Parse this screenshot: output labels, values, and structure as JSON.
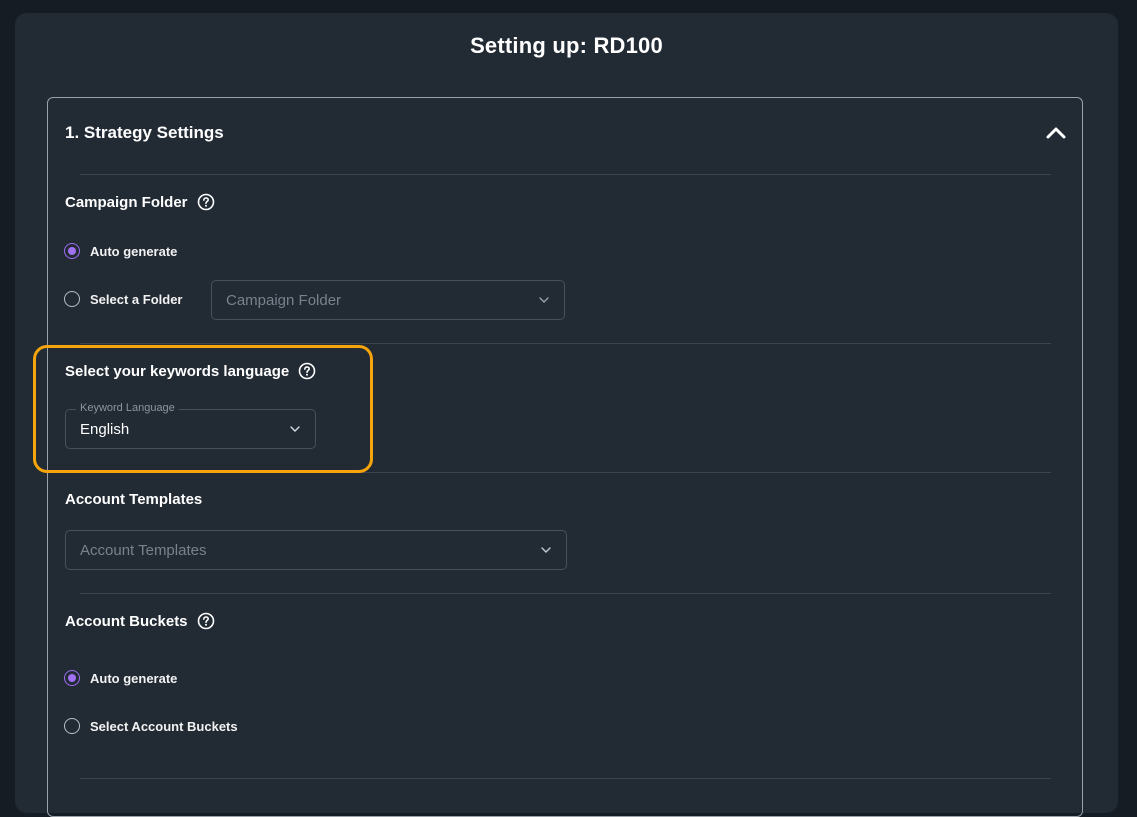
{
  "page": {
    "title": "Setting up: RD100"
  },
  "strategy": {
    "title": "1. Strategy Settings",
    "collapse_icon": "chevron-up-icon",
    "campaign_folder": {
      "heading": "Campaign Folder",
      "options": [
        {
          "label": "Auto generate",
          "selected": true
        },
        {
          "label": "Select a Folder",
          "selected": false
        }
      ],
      "select_placeholder": "Campaign Folder"
    },
    "keyword_language": {
      "heading": "Select your keywords language",
      "field_label": "Keyword Language",
      "value": "English"
    },
    "account_templates": {
      "heading": "Account Templates",
      "select_placeholder": "Account Templates"
    },
    "account_buckets": {
      "heading": "Account Buckets",
      "options": [
        {
          "label": "Auto generate",
          "selected": true
        },
        {
          "label": "Select Account Buckets",
          "selected": false
        }
      ]
    }
  },
  "colors": {
    "background": "#161c23",
    "panel": "#222a34",
    "accent_radio": "#a271f2",
    "highlight": "#f5a40b"
  }
}
